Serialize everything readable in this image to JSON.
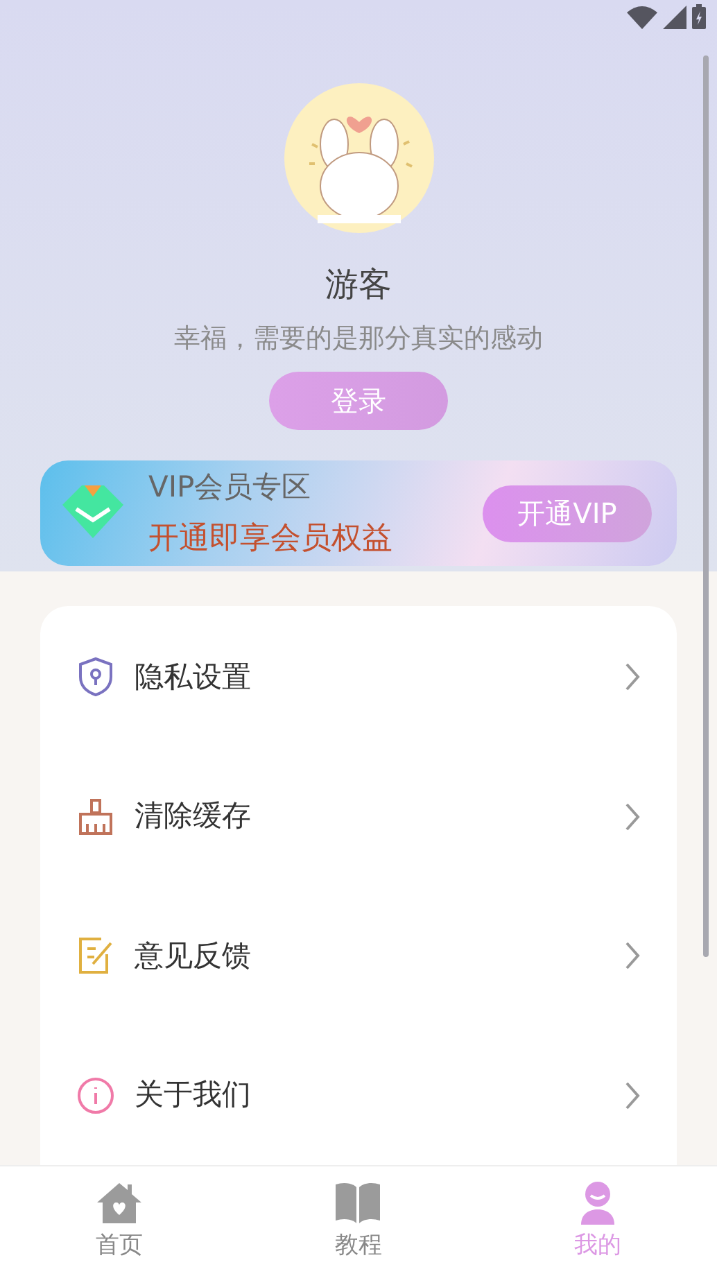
{
  "profile": {
    "name": "游客",
    "motto": "幸福，需要的是那分真实的感动",
    "login_button": "登录"
  },
  "vip": {
    "title": "VIP会员专区",
    "subtitle": "开通即享会员权益",
    "button": "开通VIP"
  },
  "menu": [
    {
      "kind": "privacy",
      "label": "隐私设置"
    },
    {
      "kind": "cache",
      "label": "清除缓存"
    },
    {
      "kind": "feedback",
      "label": "意见反馈"
    },
    {
      "kind": "about",
      "label": "关于我们"
    }
  ],
  "tab_bar": [
    {
      "kind": "home",
      "label": "首页",
      "selected": false
    },
    {
      "kind": "book",
      "label": "教程",
      "selected": false
    },
    {
      "kind": "user",
      "label": "我的",
      "selected": true
    }
  ]
}
